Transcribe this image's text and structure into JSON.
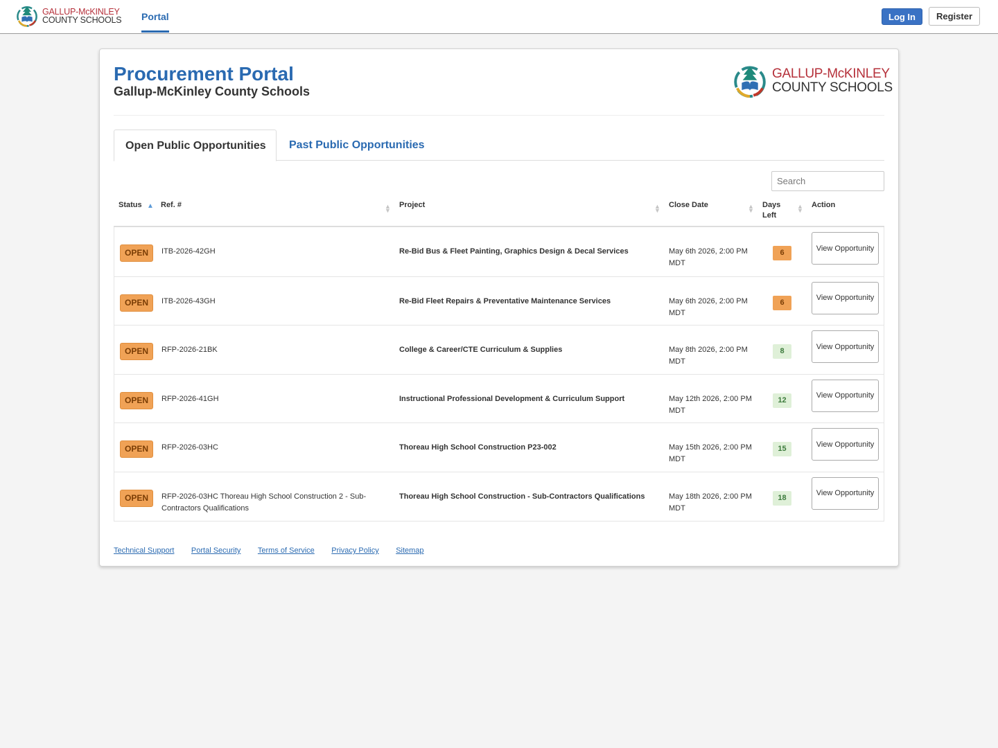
{
  "nav": {
    "logo_line1": "GALLUP-McKINLEY",
    "logo_line2": "COUNTY SCHOOLS",
    "portal_link": "Portal",
    "login_label": "Log In",
    "register_label": "Register"
  },
  "header": {
    "title": "Procurement Portal",
    "subtitle": "Gallup-McKinley County Schools",
    "logo_line1": "GALLUP-McKINLEY",
    "logo_line2": "COUNTY SCHOOLS"
  },
  "tabs": [
    {
      "label": "Open Public Opportunities",
      "active": true
    },
    {
      "label": "Past Public Opportunities",
      "active": false
    }
  ],
  "search": {
    "placeholder": "Search",
    "value": ""
  },
  "table": {
    "columns": [
      "Status",
      "Ref. #",
      "Project",
      "Close Date",
      "Days Left",
      "Action"
    ],
    "rows": [
      {
        "status": "OPEN",
        "ref": "ITB-2026-42GH",
        "project": "Re-Bid Bus & Fleet Painting, Graphics Design & Decal Services",
        "close_date": "May 6th 2026, 2:00 PM MDT",
        "days_left": "6",
        "days_color": "orange",
        "action": "View Opportunity"
      },
      {
        "status": "OPEN",
        "ref": "ITB-2026-43GH",
        "project": "Re-Bid Fleet Repairs & Preventative Maintenance Services",
        "close_date": "May 6th 2026, 2:00 PM MDT",
        "days_left": "6",
        "days_color": "orange",
        "action": "View Opportunity"
      },
      {
        "status": "OPEN",
        "ref": "RFP-2026-21BK",
        "project": "College & Career/CTE Curriculum & Supplies",
        "close_date": "May 8th 2026, 2:00 PM MDT",
        "days_left": "8",
        "days_color": "green",
        "action": "View Opportunity"
      },
      {
        "status": "OPEN",
        "ref": "RFP-2026-41GH",
        "project": "Instructional Professional Development & Curriculum Support",
        "close_date": "May 12th 2026, 2:00 PM MDT",
        "days_left": "12",
        "days_color": "green",
        "action": "View Opportunity"
      },
      {
        "status": "OPEN",
        "ref": "RFP-2026-03HC",
        "project": "Thoreau High School Construction P23-002",
        "close_date": "May 15th 2026, 2:00 PM MDT",
        "days_left": "15",
        "days_color": "green",
        "action": "View Opportunity"
      },
      {
        "status": "OPEN",
        "ref": "RFP-2026-03HC Thoreau High School Construction 2 - Sub-Contractors Qualifications",
        "project": "Thoreau High School Construction - Sub-Contractors Qualifications",
        "close_date": "May 18th 2026, 2:00 PM MDT",
        "days_left": "18",
        "days_color": "green",
        "action": "View Opportunity"
      }
    ]
  },
  "footer": {
    "links": [
      "Technical Support",
      "Portal Security",
      "Terms of Service",
      "Privacy Policy",
      "Sitemap"
    ]
  },
  "colors": {
    "brand_blue": "#2a6ab1",
    "open_badge": "#f0a256",
    "days_green": "#dff0d8",
    "logo_red": "#b5303a"
  }
}
